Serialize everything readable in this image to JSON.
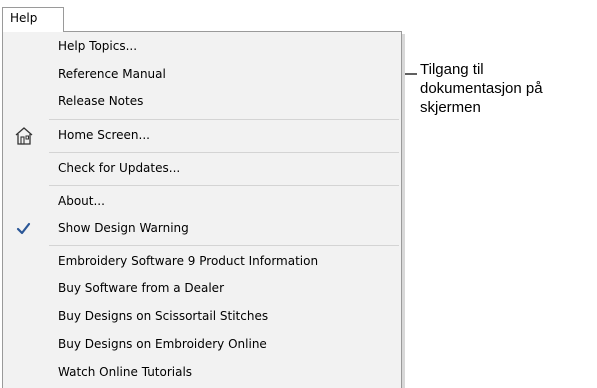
{
  "menu": {
    "title": "Help",
    "items": [
      {
        "label": "Help Topics..."
      },
      {
        "label": "Reference Manual"
      },
      {
        "label": "Release Notes"
      },
      {
        "label": "Home Screen...",
        "icon": "home-screen-icon"
      },
      {
        "label": "Check for Updates..."
      },
      {
        "label": "About..."
      },
      {
        "label": "Show Design Warning",
        "checked": true,
        "icon": "checkmark-icon"
      },
      {
        "label": "Embroidery Software 9 Product Information"
      },
      {
        "label": "Buy Software from a Dealer"
      },
      {
        "label": "Buy Designs on Scissortail Stitches"
      },
      {
        "label": "Buy Designs on Embroidery Online"
      },
      {
        "label": "Watch Online Tutorials"
      }
    ]
  },
  "callout": {
    "lines": [
      "Tilgang til",
      "dokumentasjon på",
      "skjermen"
    ]
  },
  "colors": {
    "menu_background": "#f2f2f2",
    "menu_border": "#9a9a9a",
    "checkmark": "#2b5797"
  }
}
